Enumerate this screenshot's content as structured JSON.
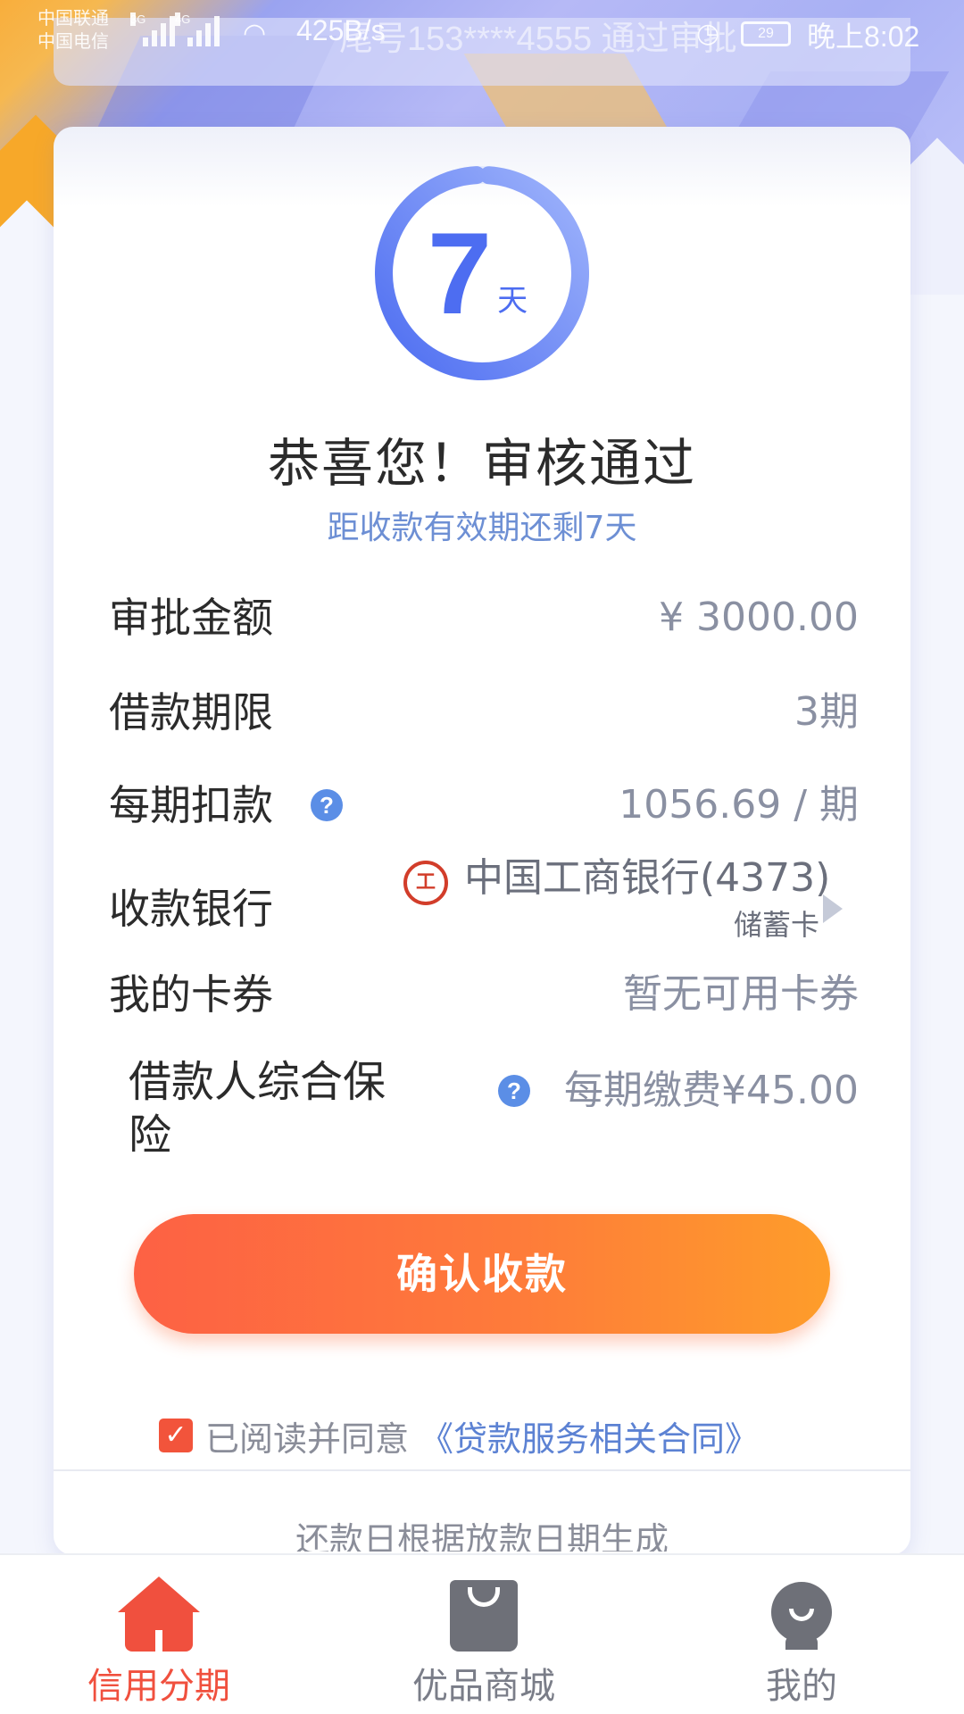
{
  "status_bar": {
    "carrier1": "中国联通",
    "carrier2": "中国电信",
    "net1": "3G",
    "net2": "4G",
    "speed": "425B/s",
    "notice": "尾号153****4555 通过审批",
    "battery": "29",
    "time": "晚上8:02"
  },
  "countdown": {
    "days": "7",
    "unit": "天",
    "remaining_fraction": 1.0
  },
  "header": {
    "title": "恭喜您！审核通过",
    "subtitle": "距收款有效期还剩7天"
  },
  "details": {
    "amount_label": "审批金额",
    "amount_value": "¥ 3000.00",
    "term_label": "借款期限",
    "term_value": "3期",
    "installment_label": "每期扣款",
    "installment_value": "1056.69 / 期",
    "bank_label": "收款银行",
    "bank_name": "中国工商银行(4373)",
    "bank_card_type": "储蓄卡",
    "coupon_label": "我的卡券",
    "coupon_value": "暂无可用卡券",
    "insurance_label": "借款人综合保险",
    "insurance_value": "每期缴费¥45.00"
  },
  "actions": {
    "confirm_label": "确认收款",
    "agree_text": "已阅读并同意",
    "contract_link": "《贷款服务相关合同》",
    "agreed": true
  },
  "footnote": "还款日根据放款日期生成",
  "bottom_nav": {
    "items": [
      {
        "label": "信用分期",
        "icon": "home-icon",
        "active": true
      },
      {
        "label": "优品商城",
        "icon": "bag-icon",
        "active": false
      },
      {
        "label": "我的",
        "icon": "profile-icon",
        "active": false
      }
    ]
  },
  "colors": {
    "accent_blue": "#4d6df1",
    "accent_orange": "#fe7b3a",
    "active_red": "#f0503e"
  }
}
